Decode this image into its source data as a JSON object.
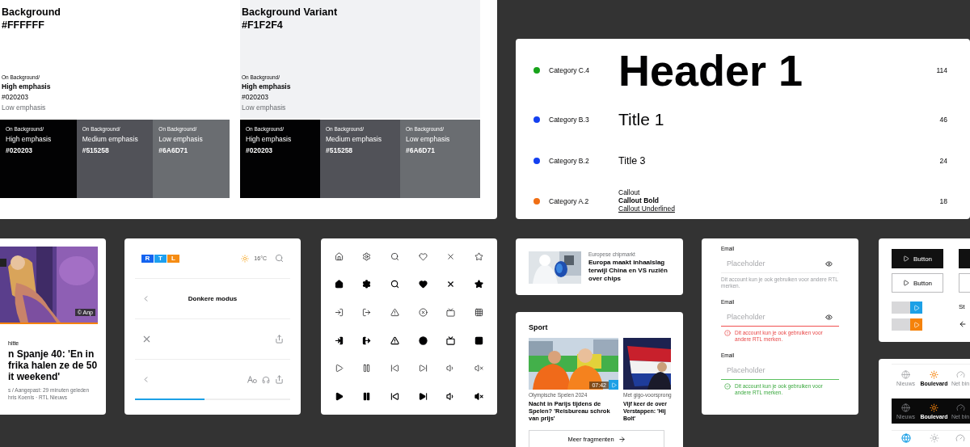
{
  "palette": {
    "panels": [
      {
        "title": "Background",
        "hex": "#FFFFFF",
        "color": "#ffffff",
        "sample": {
          "label": "On Background/",
          "high": "High emphasis",
          "hex": "#020203",
          "low": "Low emphasis"
        },
        "swatches": [
          {
            "label": "On Background/",
            "name": "High emphasis",
            "hex": "#020203",
            "color": "#020203"
          },
          {
            "label": "On Background/",
            "name": "Medium emphasis",
            "hex": "#515258",
            "color": "#515258"
          },
          {
            "label": "On Background/",
            "name": "Low emphasis",
            "hex": "#6A6D71",
            "color": "#6a6d71"
          }
        ]
      },
      {
        "title": "Background Variant",
        "hex": "#F1F2F4",
        "color": "#f1f2f4",
        "sample": {
          "label": "On Background/",
          "high": "High emphasis",
          "hex": "#020203",
          "low": "Low emphasis"
        },
        "swatches": [
          {
            "label": "On Background/",
            "name": "High emphasis",
            "hex": "#020203",
            "color": "#020203"
          },
          {
            "label": "On Background/",
            "name": "Medium emphasis",
            "hex": "#515258",
            "color": "#515258"
          },
          {
            "label": "On Background/",
            "name": "Low emphasis",
            "hex": "#6A6D71",
            "color": "#6a6d71"
          }
        ]
      }
    ]
  },
  "typography": {
    "rows": [
      {
        "category": "Category C.4",
        "color": "#17a31a",
        "kind": "header",
        "samples": [
          {
            "text": "Header 1",
            "kind": "regular"
          }
        ],
        "size": "114"
      },
      {
        "category": "Category B.3",
        "color": "#1440f0",
        "kind": "title",
        "samples": [
          {
            "text": "Title 1",
            "kind": "regular"
          }
        ],
        "size": "46"
      },
      {
        "category": "Category B.2",
        "color": "#1440f0",
        "kind": "subtitle",
        "samples": [
          {
            "text": "Title 3",
            "kind": "regular"
          }
        ],
        "size": "24"
      },
      {
        "category": "Category A.2",
        "color": "#f06e14",
        "kind": "callout",
        "samples": [
          {
            "text": "Callout",
            "kind": "regular"
          },
          {
            "text": "Callout Bold",
            "kind": "bold"
          },
          {
            "text": "Callout Underlined",
            "kind": "underlined"
          }
        ],
        "size": "18"
      }
    ]
  },
  "news_card": {
    "credit": "© Anp",
    "kicker": "hitte",
    "headline": "n Spanje 40: 'En in\nfrika halen ze de 50\nit weekend'",
    "meta": [
      "s / Aangepast: 29 minuten geleden",
      "hris Koenis · RTL Nieuws"
    ]
  },
  "nav_card": {
    "logo": [
      "R",
      "T",
      "L"
    ],
    "temperature": "16°C",
    "title": "Donkere modus",
    "progress": {
      "level": 0.45
    }
  },
  "article_card": {
    "kicker": "Europese chipmarkt",
    "headline": "Europa maakt inhaalslag terwijl China en VS ruziën over chips"
  },
  "sport_card": {
    "title": "Sport",
    "items": [
      {
        "kicker": "Olympische Spelen 2024",
        "headline": "Nacht in Parijs tijdens de Spelen? 'Reisbureau schrok van prijs'",
        "duration": "07:42"
      },
      {
        "kicker": "Met gigo-voorsprong",
        "headline": "Vijf keer de over\nVerstappen: 'Hij\nBolt'"
      }
    ],
    "button": "Meer fragmenten"
  },
  "form": {
    "fields": [
      {
        "label": "Email",
        "placeholder": "Placeholder",
        "hint": "Dit account kun je ook gebruiken voor andere RTL merken.",
        "kind": "default",
        "eye": true
      },
      {
        "label": "Email",
        "placeholder": "Placeholder",
        "hint": "Dit account kun je ook gebruiken voor andere RTL merken.",
        "kind": "error",
        "eye": true
      },
      {
        "label": "Email",
        "placeholder": "Placeholder",
        "hint": "Dit account kun je ook gebruiken voor andere RTL merken.",
        "kind": "success",
        "eye": false
      }
    ]
  },
  "buttons_card": {
    "buttons": [
      {
        "label": "Button",
        "kind": "solid"
      },
      {
        "label": "Button",
        "kind": "outline"
      }
    ],
    "players": [
      {
        "color": "#1ca0e6"
      },
      {
        "color": "#f5820a"
      }
    ],
    "text": "St"
  },
  "tab_bars": [
    {
      "kind": "light",
      "tabs": [
        {
          "label": "Nieuws",
          "selected": false
        },
        {
          "label": "Boulevard",
          "selected": true
        },
        {
          "label": "Net bin",
          "selected": false
        }
      ]
    },
    {
      "kind": "dark",
      "tabs": [
        {
          "label": "Nieuws",
          "selected": false
        },
        {
          "label": "Boulevard",
          "selected": true
        },
        {
          "label": "Net bin",
          "selected": false
        }
      ]
    },
    {
      "kind": "light",
      "tabs": [
        {
          "selected": true
        },
        {
          "selected": false
        },
        {
          "selected": false
        }
      ]
    }
  ]
}
